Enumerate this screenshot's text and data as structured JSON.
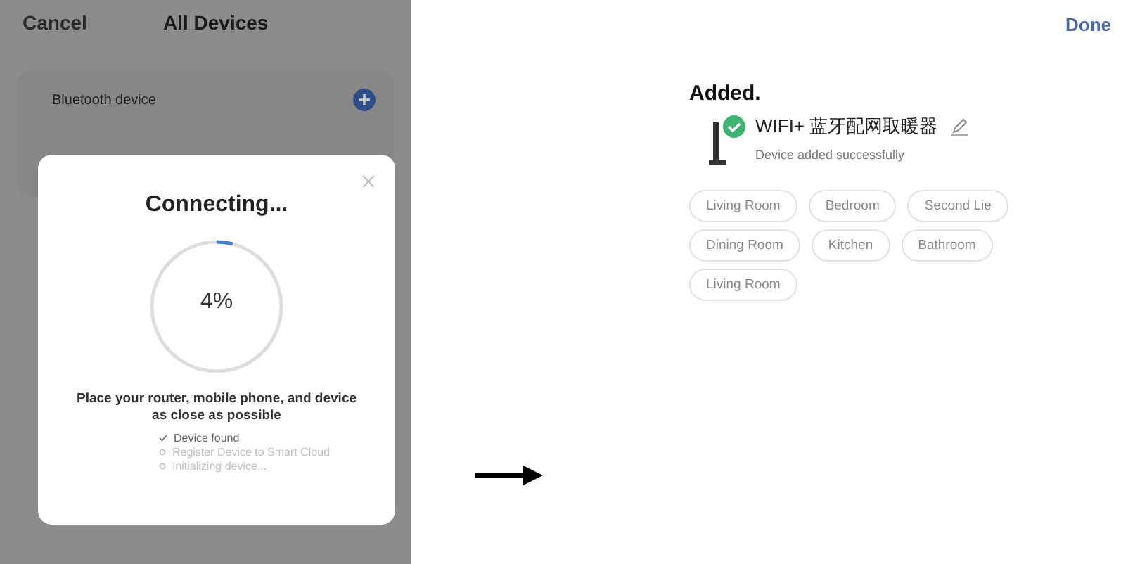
{
  "left_screen": {
    "cancel": "Cancel",
    "title": "All Devices",
    "list_item": {
      "label": "Bluetooth device"
    },
    "dialog": {
      "title": "Connecting...",
      "progress": {
        "level": 0.04,
        "reading": "4%"
      },
      "hint": "Place your router, mobile phone, and device as close as possible",
      "steps": [
        {
          "label": "Device found",
          "done": true
        },
        {
          "label": "Register Device to Smart Cloud",
          "done": false
        },
        {
          "label": "Initializing device...",
          "done": false
        }
      ]
    }
  },
  "right_screen": {
    "done": "Done",
    "heading": "Added.",
    "device": {
      "name": "WIFI+ 蓝牙配网取暖器",
      "status": "Device added successfully"
    },
    "rooms": [
      "Living Room",
      "Bedroom",
      "Second Lie",
      "Dining Room",
      "Kitchen",
      "Bathroom",
      "Living Room"
    ]
  }
}
